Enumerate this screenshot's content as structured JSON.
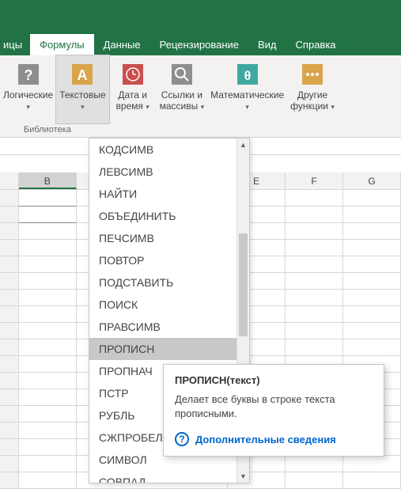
{
  "tabs": {
    "partial": "ицы",
    "active": "Формулы",
    "items": [
      "Данные",
      "Рецензирование",
      "Вид",
      "Справка"
    ]
  },
  "ribbon": {
    "logical": "Логические",
    "text": "Текстовые",
    "datetime_l1": "Дата и",
    "datetime_l2": "время",
    "lookup_l1": "Ссылки и",
    "lookup_l2": "массивы",
    "math": "Математические",
    "more_l1": "Другие",
    "more_l2": "функции",
    "group_label": "Библиотека"
  },
  "columns": [
    "B",
    "E",
    "F",
    "G"
  ],
  "dropdown": {
    "items": [
      "КОДСИМВ",
      "ЛЕВСИМВ",
      "НАЙТИ",
      "ОБЪЕДИНИТЬ",
      "ПЕЧСИМВ",
      "ПОВТОР",
      "ПОДСТАВИТЬ",
      "ПОИСК",
      "ПРАВСИМВ",
      "ПРОПИСН",
      "ПРОПНАЧ",
      "ПСТР",
      "РУБЛЬ",
      "СЖПРОБЕЛЫ",
      "СИМВОЛ",
      "СОВПАД"
    ],
    "hover_index": 9
  },
  "tooltip": {
    "title": "ПРОПИСН(текст)",
    "desc": "Делает все буквы в строке текста прописными.",
    "link": "Дополнительные сведения"
  }
}
